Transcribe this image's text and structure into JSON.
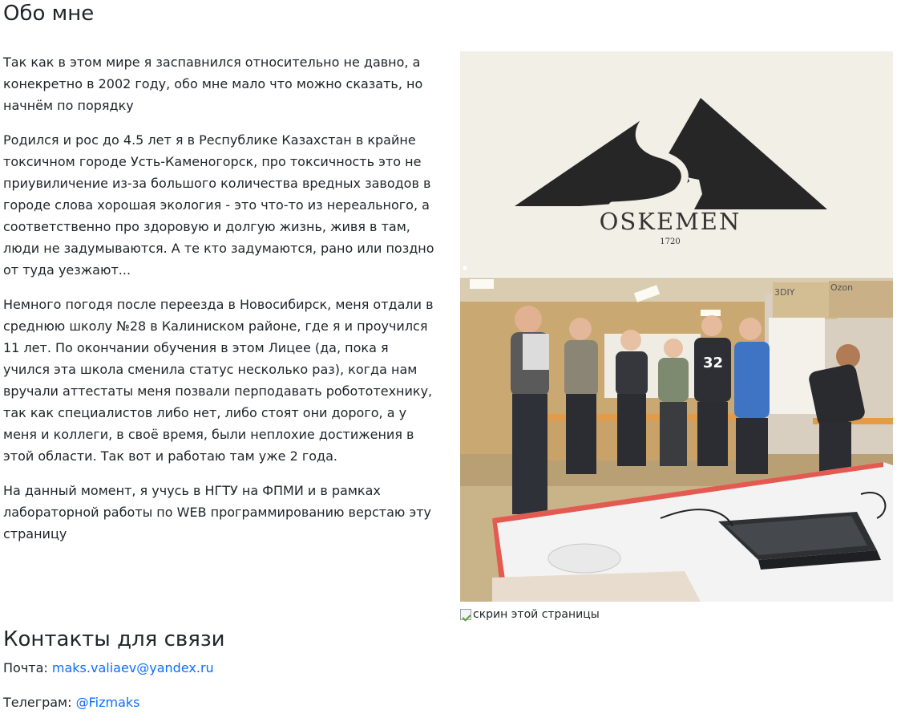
{
  "about": {
    "title": "Обо мне",
    "paragraphs": [
      "Так как в этом мире я заспавнился относительно не давно, а конекретно в 2002 году, обо мне мало что можно сказать, но начнём по порядку",
      "Родился и рос до 4.5 лет я в Республике Казахстан в крайне токсичном городе Усть-Каменогорск, про токсичность это не приувиличение из-за большого количества вредных заводов в городе слова хорошая экология - это что-то из нереального, а соответственно про здоровую и долгую жизнь, живя в там, люди не задумываются. А те кто задумаются, рано или поздно от туда уезжают...",
      "Немного погодя после переезда в Новосибирск, меня отдали в среднюю школу №28 в Калиниском районе, где я и проучился 11 лет. По окончании обучения в этом Лицее (да, пока я учился эта школа сменила статус несколько раз), когда нам вручали аттестаты меня позвали перподавать робототехнику, так как специалистов либо нет, либо стоят они дорого, а у меня и коллеги, в своё время, были неплохие достижения в этой области. Так вот и работаю там уже 2 года.",
      "На данный момент, я учусь в НГТУ на ФПМИ и в рамках лабораторной работы по WEB программированию верстаю эту страницу"
    ]
  },
  "images": {
    "oskemen_logo": {
      "wordmark": "OSKEMEN",
      "year": "1720"
    },
    "photo": {
      "box_labels": [
        "3DIY",
        "Ozon"
      ],
      "shirt_number": "32"
    },
    "broken_alt": "скрин этой страницы"
  },
  "contacts": {
    "title": "Контакты для связи",
    "mail_label": "Почта:",
    "mail_value": "maks.valiaev@yandex.ru",
    "telegram_label": "Телеграм:",
    "telegram_value": "@Fizmaks"
  },
  "colors": {
    "link": "#0d6efd",
    "text": "#212529"
  }
}
